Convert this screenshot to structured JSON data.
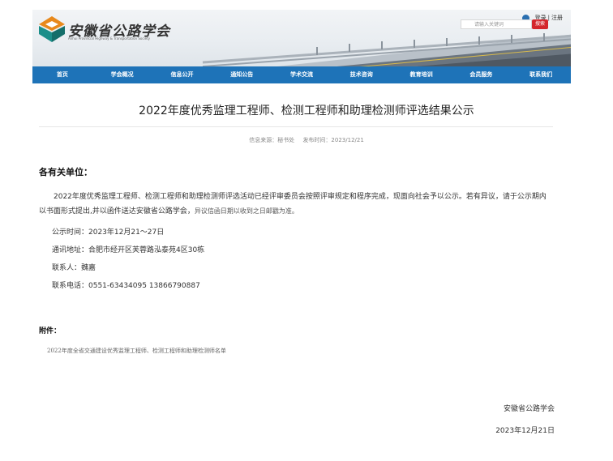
{
  "header": {
    "site_name": "安徽省公路学会",
    "site_subtitle": "Anhui Provincial Highway & Transportation Society",
    "login_label": "登录",
    "separator": "|",
    "register_label": "注册",
    "search_placeholder": "请输入关键词",
    "search_button": "搜索"
  },
  "nav": {
    "items": [
      "首页",
      "学会概况",
      "信息公开",
      "通知公告",
      "学术交流",
      "技术咨询",
      "教育培训",
      "会员服务",
      "联系我们"
    ]
  },
  "article": {
    "title": "2022年度优秀监理工程师、检测工程师和助理检测师评选结果公示",
    "source_label": "信息来源：秘书处",
    "date_label": "发布时间：2023/12/21",
    "greeting": "各有关单位：",
    "paragraph": "2022年度优秀监理工程师、检测工程师和助理检测师评选活动已经评审委员会按照评审规定和程序完成，现面向社会予以公示。若有异议，请于公示期内以书面形式提出,并以函件送达安徽省公路学会，",
    "paragraph_note": "异议信函日期以收到之日邮戳为准。",
    "period": "公示时间：2023年12月21～27日",
    "address": "通讯地址：合肥市经开区芙蓉路泓泰苑4区30栋",
    "contact": "联系人：魏嘉",
    "phone": "联系电话：0551-63434095   13866790887",
    "attachment_label": "附件：",
    "attachment_file": "2022年度全省交通建设优秀监理工程师、检测工程师和助理检测师名单",
    "signer": "安徽省公路学会",
    "sign_date": "2023年12月21日"
  },
  "colors": {
    "nav_bg": "#1e73b8",
    "search_button": "#d4262b",
    "logo_orange": "#e8891c",
    "logo_teal": "#1c8f8a"
  }
}
